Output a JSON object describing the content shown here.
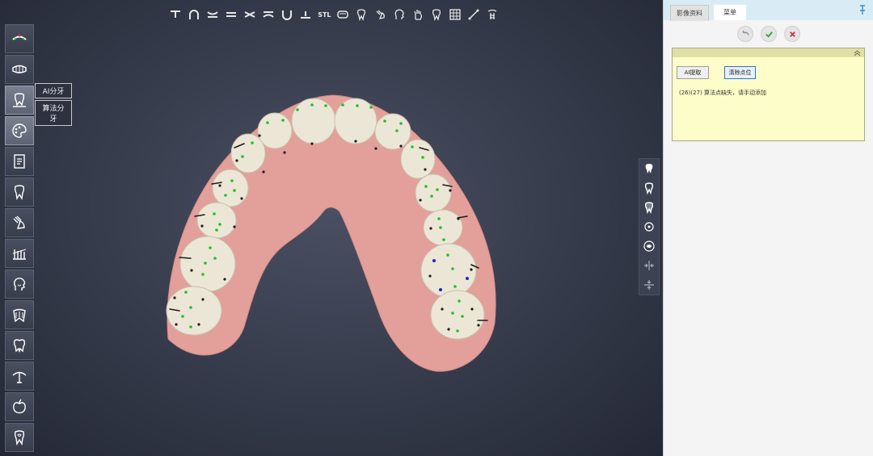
{
  "top_toolbar": {
    "icons": [
      "occlusal-plane-icon",
      "arch-icon",
      "upper-jaw-icon",
      "equal-icon",
      "bite-icon",
      "lower-jaw-icon",
      "u-shape-icon",
      "baseline-icon",
      "stl-icon",
      "jaw-model-icon",
      "tooth-icon",
      "hand-tooth-icon",
      "head-icon",
      "hand-icon",
      "tooth-outline-icon",
      "grid-icon",
      "measure-icon",
      "implant-icon"
    ],
    "stl_label": "STL"
  },
  "left_toolbar": {
    "buttons": [
      "dental-arch-icon",
      "full-arch-icon",
      "tooth-segment-icon",
      "palette-icon",
      "document-icon",
      "single-tooth-icon",
      "hand-tooth-icon",
      "tooth-grid-icon",
      "face-icon",
      "crown-icon",
      "molar-icon",
      "jaw-joint-icon",
      "apple-icon",
      "tooth-heart-icon"
    ],
    "popup": {
      "ai_split": "AI分牙",
      "algo_split": "算法分牙"
    }
  },
  "right_toolbar": {
    "buttons": [
      "tooth-front-icon",
      "tooth-side-icon",
      "tooth-back-icon",
      "target-icon",
      "eye-icon",
      "horizontal-align-icon",
      "vertical-align-icon"
    ]
  },
  "panel": {
    "tabs": [
      "影像资料",
      "菜单"
    ],
    "active_tab": "菜单",
    "actions": [
      "undo-icon",
      "confirm-icon",
      "cancel-icon"
    ],
    "sub_panel": {
      "ai_button": "AI提取",
      "clear_button": "清除点位",
      "message": "(26)(27) 算法点缺失，请手动添加"
    }
  },
  "colors": {
    "viewport_bg": "#353a4a",
    "gum": "#e3a09a",
    "tooth": "#ece6d6",
    "point_green": "#22c02a",
    "point_blue": "#1a2ac9",
    "point_black": "#1c1c1c",
    "panel_bg": "#f4f4f4",
    "sub_panel_bg": "#fdfdca",
    "confirm": "#3ba13b",
    "cancel": "#d9303a"
  }
}
